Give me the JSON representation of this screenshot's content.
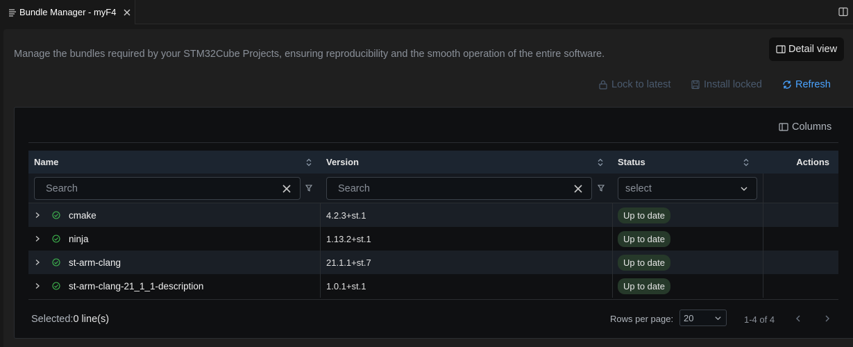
{
  "tab": {
    "title": "Bundle Manager - myF4"
  },
  "description": "Manage the bundles required by your STM32Cube Projects, ensuring reproducibility and the smooth operation of the entire software.",
  "detail_view_label": "Detail view",
  "actions": {
    "lock_label": "Lock to latest",
    "install_label": "Install locked",
    "refresh_label": "Refresh"
  },
  "columns_label": "Columns",
  "table": {
    "headers": {
      "name": "Name",
      "version": "Version",
      "status": "Status",
      "actions": "Actions"
    },
    "filters": {
      "name_placeholder": "Search",
      "version_placeholder": "Search",
      "status_placeholder": "select"
    },
    "rows": [
      {
        "name": "cmake",
        "version": "4.2.3+st.1",
        "status": "Up to date"
      },
      {
        "name": "ninja",
        "version": "1.13.2+st.1",
        "status": "Up to date"
      },
      {
        "name": "st-arm-clang",
        "version": "21.1.1+st.7",
        "status": "Up to date"
      },
      {
        "name": "st-arm-clang-21_1_1-description",
        "version": "1.0.1+st.1",
        "status": "Up to date"
      }
    ]
  },
  "footer": {
    "selected_label": "Selected:",
    "selected_value": "0 line(s)",
    "rows_per_page_label": "Rows per page:",
    "rows_per_page_value": "20",
    "page_info": "1-4 of 4"
  },
  "colors": {
    "accent": "#4aa3ff",
    "success": "#3fb950",
    "badge_bg": "#26392a"
  }
}
